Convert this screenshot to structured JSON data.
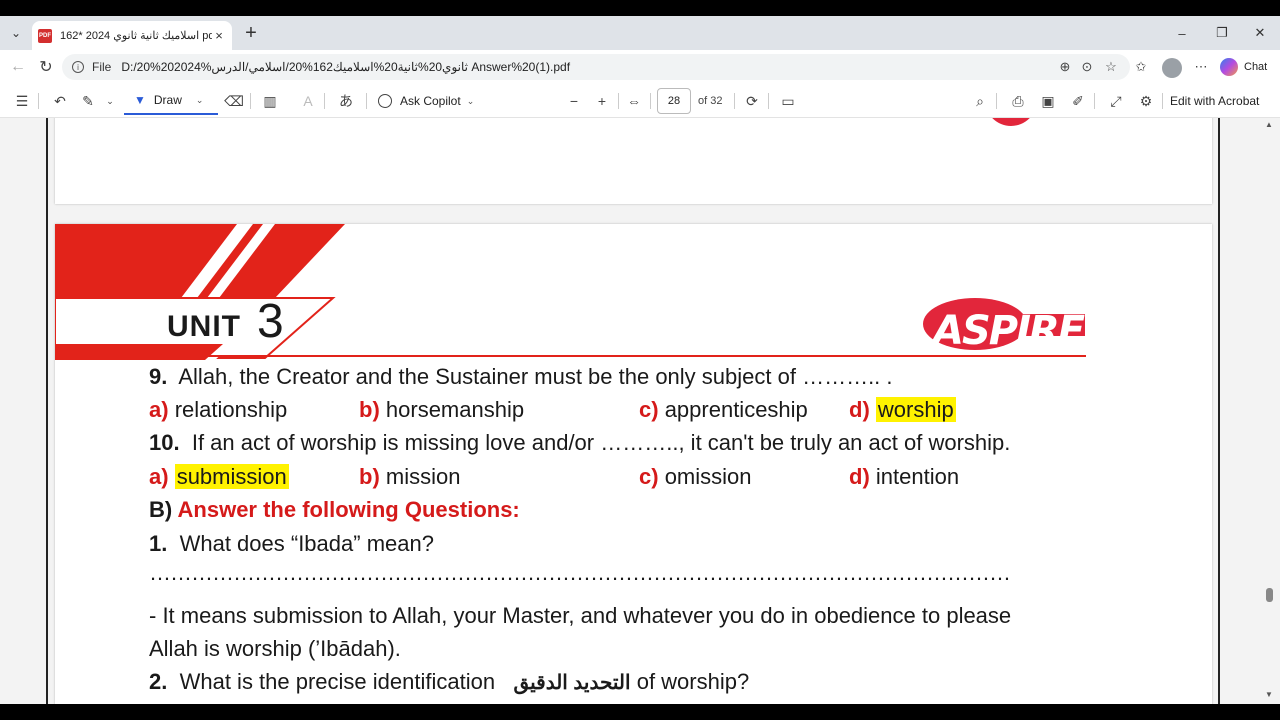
{
  "browser": {
    "tab": {
      "title": "162* اسلاميك ثانية ثانوي 2024 pdf.(",
      "pdf_badge": "PDF",
      "close": "×"
    },
    "new_tab": "+",
    "window": {
      "minimize": "–",
      "restore": "❐",
      "close": "✕"
    },
    "address": {
      "file_label": "File",
      "url": "D:/20%202024%ثانوي20%ثانية20%اسلاميك162%20/اسلامي/الدرس Answer%20(1).pdf"
    },
    "chat_label": "Chat"
  },
  "pdf_toolbar": {
    "draw_label": "Draw",
    "ask_copilot_label": "Ask Copilot",
    "page_number": "28",
    "page_total": "of 32",
    "edit_acrobat_label": "Edit with Acrobat"
  },
  "document": {
    "unit_label": "UNIT",
    "unit_number": "3",
    "logo": "ASPIRE",
    "q9": {
      "num": "9.",
      "text": "Allah, the Creator and the Sustainer must be the only subject of ……….. .",
      "options": [
        {
          "letter": "a)",
          "text": "relationship"
        },
        {
          "letter": "b)",
          "text": "horsemanship"
        },
        {
          "letter": "c)",
          "text": "apprenticeship"
        },
        {
          "letter": "d)",
          "text": "worship"
        }
      ]
    },
    "q10": {
      "num": "10.",
      "text": "If an act of worship is missing love and/or ……….., it can't be truly an act of worship.",
      "options": [
        {
          "letter": "a)",
          "text": "submission"
        },
        {
          "letter": "b)",
          "text": "mission"
        },
        {
          "letter": "c)",
          "text": "omission"
        },
        {
          "letter": "d)",
          "text": "intention"
        }
      ]
    },
    "section_b": {
      "letter": "B)",
      "title": "Answer the following Questions:"
    },
    "q1": {
      "num": "1.",
      "text": "What does “Ibada” mean?"
    },
    "dots": "……………………………………………………………………………………………………………",
    "answer1_line1": "- It means submission to Allah, your Master, and whatever you do in obedience to please",
    "answer1_line2": "Allah is worship (’Ibādah).",
    "q2": {
      "num": "2.",
      "text_before": "What is the precise identification",
      "arabic": "التحديد الدقيق",
      "text_after": "of worship?"
    }
  },
  "colors": {
    "accent_red": "#d51a1a",
    "highlight": "#fff200",
    "draw_blue": "#2a5bd7"
  }
}
